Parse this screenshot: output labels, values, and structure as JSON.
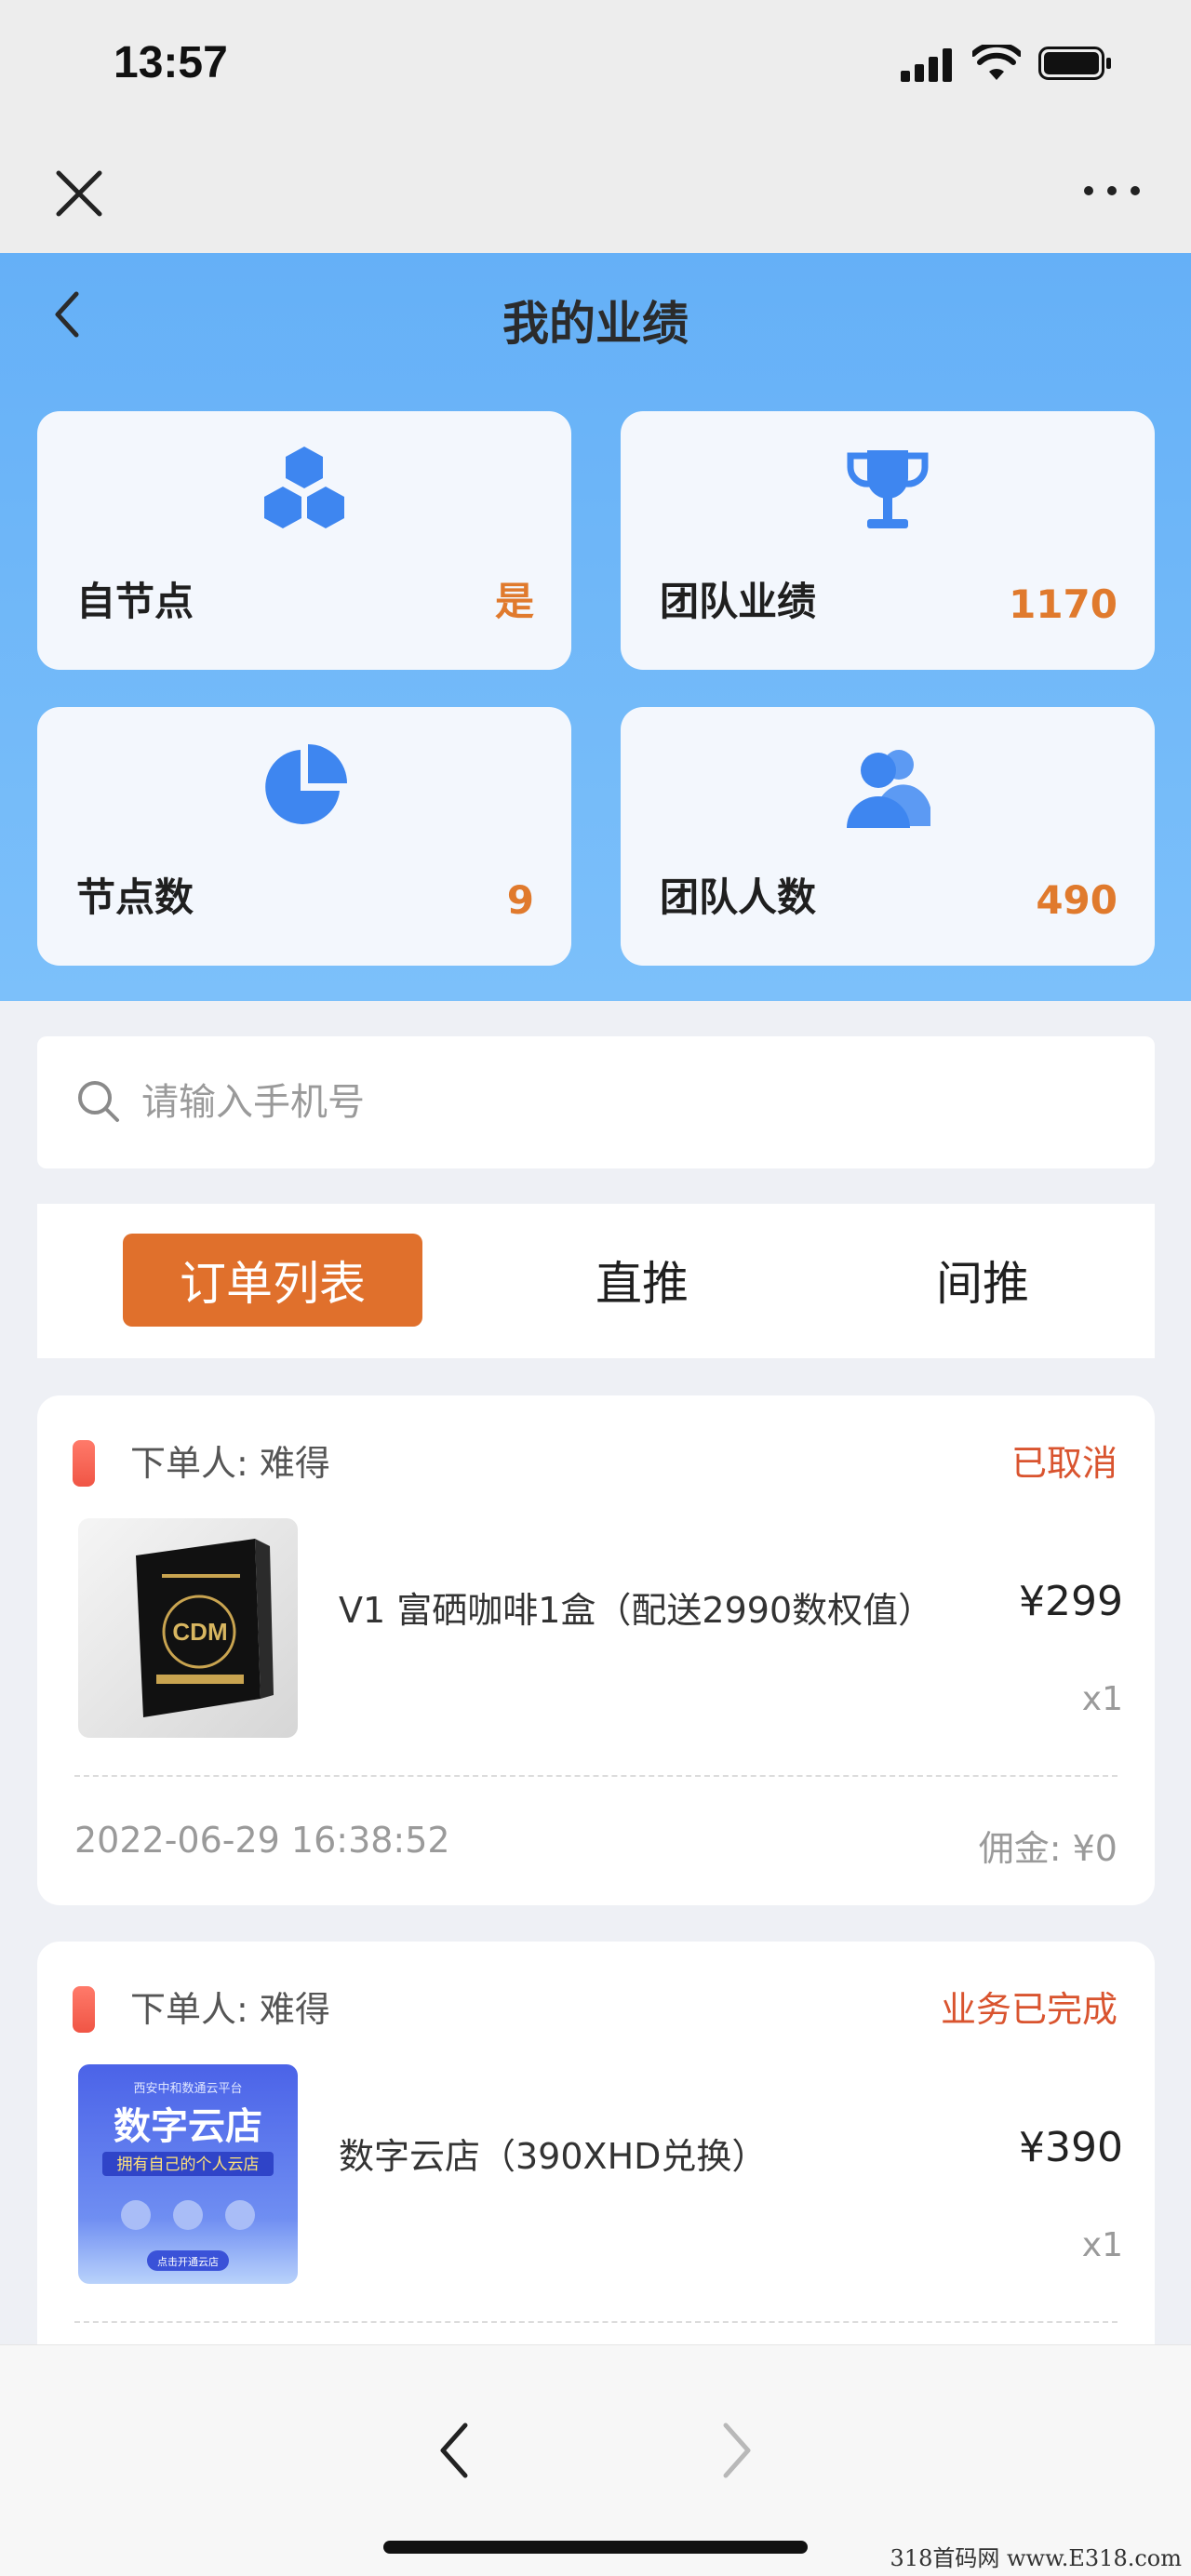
{
  "status_bar": {
    "time": "13:57"
  },
  "header": {
    "title": "我的业绩"
  },
  "stats": [
    {
      "label": "自节点",
      "value": "是",
      "icon": "hexagon-cluster-icon"
    },
    {
      "label": "团队业绩",
      "value": "1170",
      "icon": "trophy-icon"
    },
    {
      "label": "节点数",
      "value": "9",
      "icon": "pie-chart-icon"
    },
    {
      "label": "团队人数",
      "value": "490",
      "icon": "users-icon"
    }
  ],
  "search": {
    "placeholder": "请输入手机号",
    "value": ""
  },
  "tabs": [
    {
      "label": "订单列表",
      "active": true
    },
    {
      "label": "直推",
      "active": false
    },
    {
      "label": "间推",
      "active": false
    }
  ],
  "orders": [
    {
      "buyer": "下单人: 难得",
      "status": "已取消",
      "product": "V1 富硒咖啡1盒（配送2990数权值）",
      "price": "¥299",
      "qty": "x1",
      "date": "2022-06-29 16:38:52",
      "commission": "佣金: ¥0",
      "thumb_text": "CDM"
    },
    {
      "buyer": "下单人: 难得",
      "status": "业务已完成",
      "product": "数字云店（390XHD兑换）",
      "price": "¥390",
      "qty": "x1",
      "thumb_small": "西安中和数通云平台",
      "thumb_title": "数字云店",
      "thumb_sub": "拥有自己的个人云店",
      "thumb_btn": "点击开通云店"
    }
  ],
  "watermark": "318首码网 www.E318.com",
  "colors": {
    "accent": "#e0702c",
    "header_blue": "#65b0f7",
    "icon_blue": "#3e86f0",
    "status_red": "#d9542f",
    "value_orange": "#e07a2d"
  }
}
